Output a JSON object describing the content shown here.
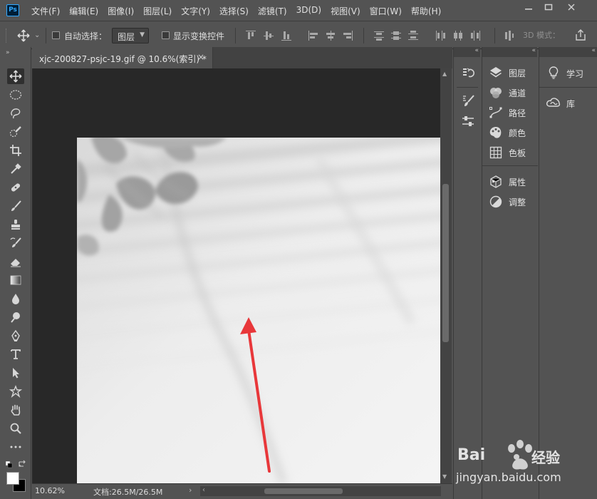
{
  "app": {
    "logo_text": "Ps",
    "menu": [
      "文件(F)",
      "编辑(E)",
      "图像(I)",
      "图层(L)",
      "文字(Y)",
      "选择(S)",
      "滤镜(T)",
      "3D(D)",
      "视图(V)",
      "窗口(W)",
      "帮助(H)"
    ],
    "window_controls": [
      "minimize",
      "maximize",
      "close"
    ]
  },
  "options_bar": {
    "auto_select_label": "自动选择：",
    "auto_select_target": "图层",
    "show_transform_label": "显示变换控件",
    "mode_3d_label": "3D 模式："
  },
  "document": {
    "tab_title": "xjc-200827-psjc-19.gif @ 10.6%(索引) *",
    "close_glyph": "×"
  },
  "status": {
    "zoom": "10.62%",
    "doc_size": "文档:26.5M/26.5M"
  },
  "panels": {
    "main": [
      "图层",
      "通道",
      "路径",
      "颜色",
      "色板"
    ],
    "secondary": [
      "属性",
      "调整"
    ],
    "learn": [
      "学习",
      "库"
    ]
  },
  "tools": [
    "move-tool",
    "marquee-tool",
    "lasso-tool",
    "quick-select-tool",
    "crop-tool",
    "eyedropper-tool",
    "healing-brush-tool",
    "brush-tool",
    "clone-stamp-tool",
    "history-brush-tool",
    "eraser-tool",
    "gradient-tool",
    "blur-tool",
    "dodge-tool",
    "pen-tool",
    "type-tool",
    "path-select-tool",
    "custom-shape-tool",
    "hand-tool",
    "zoom-tool",
    "more-tools"
  ],
  "colors": {
    "ui_bg": "#535353",
    "canvas_bg": "#282828",
    "accent_ps": "#31a8ff",
    "arrow_annotation": "#e8373a"
  },
  "watermark": {
    "brand": "Bai",
    "brand_suffix": "经验",
    "url": "jingyan.baidu.com"
  }
}
